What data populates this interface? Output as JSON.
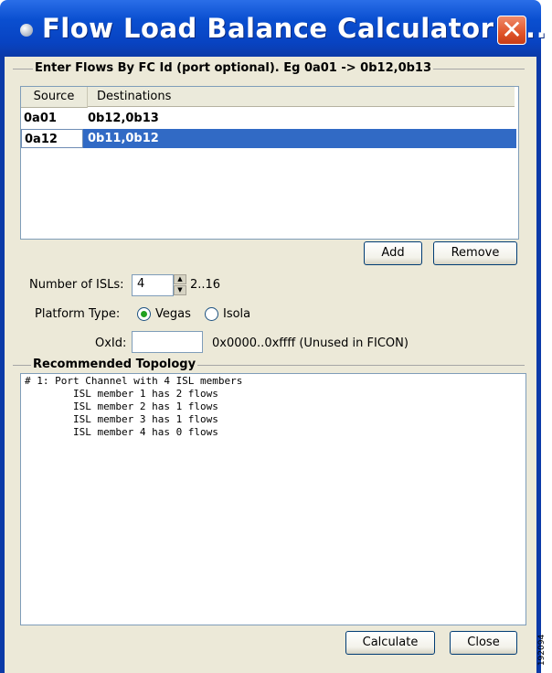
{
  "window": {
    "title": "Flow Load Balance Calculator -...",
    "close_glyph": "✕"
  },
  "flows_group": {
    "legend": "Enter Flows By FC Id (port optional). Eg 0a01 -> 0b12,0b13",
    "table": {
      "columns": [
        "Source",
        "Destinations"
      ],
      "rows": [
        {
          "source": "0a01",
          "destinations": "0b12,0b13",
          "selected": false
        },
        {
          "source": "0a12",
          "destinations": "0b11,0b12",
          "selected": true
        }
      ]
    },
    "add_label": "Add",
    "remove_label": "Remove"
  },
  "isl": {
    "label": "Number of ISLs:",
    "value": "4",
    "range": "2..16"
  },
  "platform": {
    "label": "Platform Type:",
    "options": [
      {
        "label": "Vegas",
        "checked": true
      },
      {
        "label": "Isola",
        "checked": false
      }
    ]
  },
  "oxid": {
    "label": "OxId:",
    "value": "",
    "hint": "0x0000..0xffff (Unused in FICON)"
  },
  "topology": {
    "legend": "Recommended Topology",
    "lines": [
      "# 1: Port Channel with 4 ISL members",
      "        ISL member 1 has 2 flows",
      "        ISL member 2 has 1 flows",
      "        ISL member 3 has 1 flows",
      "        ISL member 4 has 0 flows"
    ]
  },
  "footer": {
    "calculate_label": "Calculate",
    "close_label": "Close"
  },
  "side_number": "192094",
  "colors": {
    "title_bar": "#0843c2",
    "selection": "#316ac5",
    "close_button": "#e0542a",
    "dialog_bg": "#ece9d8"
  }
}
